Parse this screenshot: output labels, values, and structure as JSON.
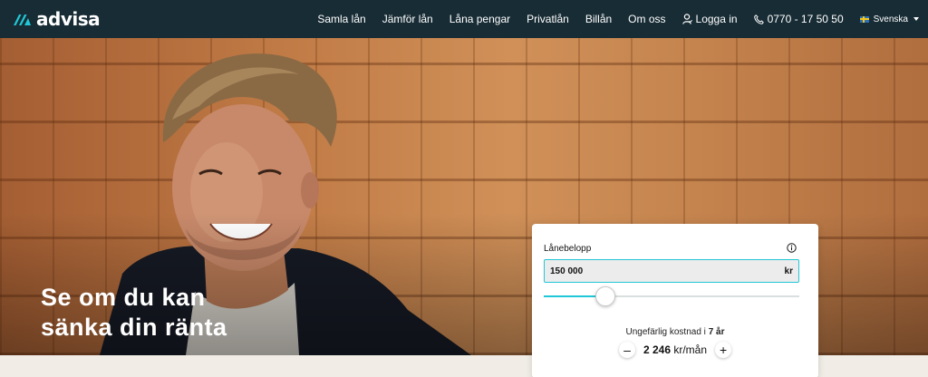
{
  "nav": {
    "logo_text": "advisa",
    "links": [
      "Samla lån",
      "Jämför lån",
      "Låna pengar",
      "Privatlån",
      "Billån",
      "Om oss"
    ],
    "login_label": "Logga in",
    "phone": "0770 - 17 50 50",
    "language": "Svenska"
  },
  "hero": {
    "title_line1": "Se om du kan",
    "title_line2": "sänka din ränta"
  },
  "calculator": {
    "amount_label": "Lånebelopp",
    "amount_value": "150 000",
    "amount_unit": "kr",
    "slider_fraction": 0.24,
    "cost_label_prefix": "Ungefärlig kostnad i ",
    "cost_label_years": "7 år",
    "monthly_value": "2 246",
    "monthly_unit": "kr/mån",
    "minus_label": "–",
    "plus_label": "+"
  },
  "colors": {
    "nav_bg": "#182c35",
    "accent": "#20c7d6"
  },
  "icons": {
    "logo": "advisa-logo-icon",
    "login": "user-icon",
    "phone": "phone-icon",
    "language": "sweden-flag-icon",
    "info": "info-icon"
  }
}
